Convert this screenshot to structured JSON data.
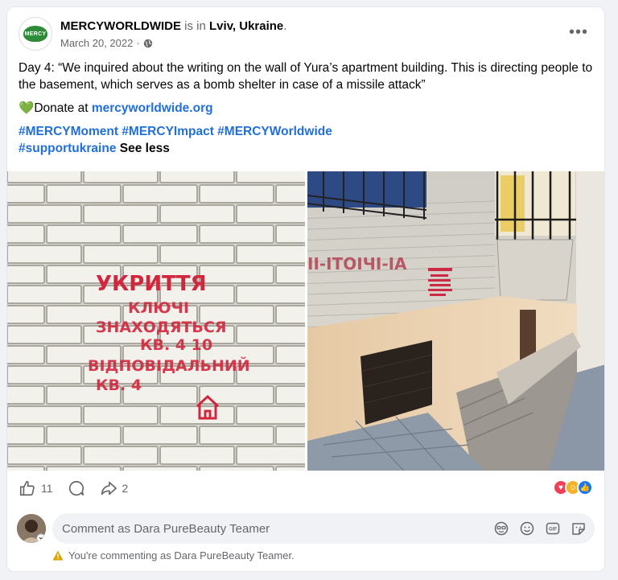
{
  "post": {
    "author": "MERCYWORLDWIDE",
    "is_in": " is in ",
    "location": "Lviv, Ukraine",
    "period": ".",
    "date": "March 20, 2022",
    "dot": "·",
    "logo_text": "MERCY",
    "more_label": "•••",
    "body": "Day 4: “We inquired about the writing on the wall of Yura’s apartment building. This is directing people to the basement, which serves as a bomb shelter in case of a missile attack”",
    "donate_prefix": "Donate at ",
    "donate_link": "mercyworldwide.org",
    "hashtags_line1": "#MERCYMoment #MERCYImpact #MERCYWorldwide",
    "hashtags_line2": "#supportukraine",
    "see_less": "See less"
  },
  "images": {
    "left_stencil": [
      "УКРИТТЯ",
      "КЛЮЧІ",
      "ЗНАХОДЯТЬСЯ",
      "КВ. 4    10",
      "ВІДПОВІДАЛЬНИЙ",
      "КВ. 4"
    ],
    "right_stencil": "ІІ-ІТОІЧІ-ІА"
  },
  "actions": {
    "like_count": "11",
    "share_count": "2"
  },
  "comment": {
    "placeholder": "Comment as Dara PureBeauty Teamer",
    "warning": "You're commenting as Dara PureBeauty Teamer.",
    "gif_label": "GIF"
  },
  "colors": {
    "accent": "#216fdb",
    "donate_heart": "#31a24c",
    "warning": "#d9a400"
  }
}
